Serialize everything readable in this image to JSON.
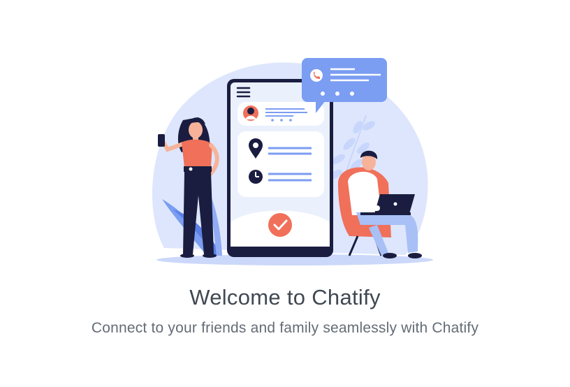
{
  "welcome": {
    "title": "Welcome to Chatify",
    "subtitle": "Connect to your friends and family seamlessly with Chatify"
  },
  "illustration": {
    "icons": [
      "menu-icon",
      "phone-icon",
      "location-pin-icon",
      "clock-icon",
      "check-icon"
    ],
    "colors": {
      "accent": "#7b9df2",
      "light_blue": "#dde6fc",
      "coral": "#f0705a",
      "navy": "#1a1d40",
      "text_dark": "#404852",
      "text_muted": "#646c76"
    }
  }
}
